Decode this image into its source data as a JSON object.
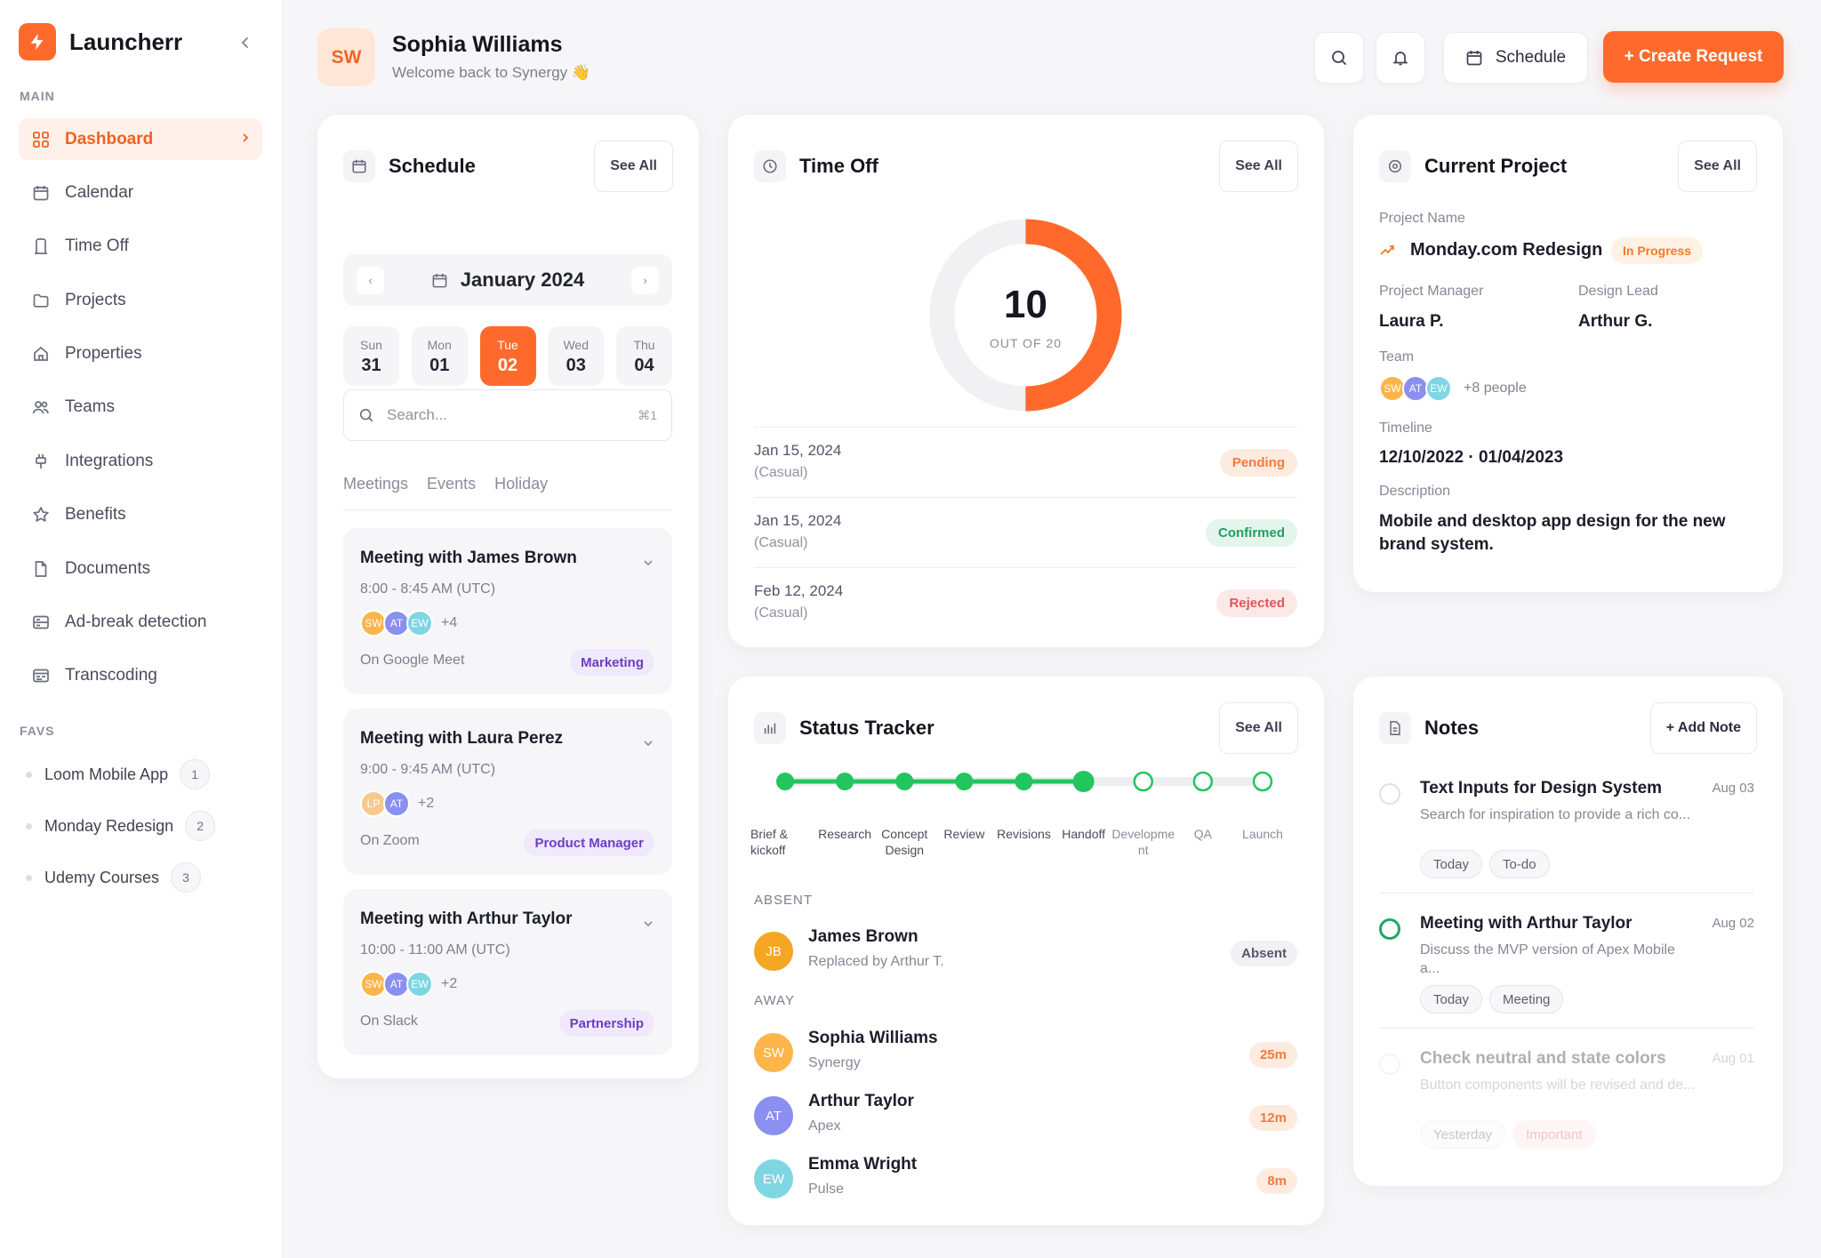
{
  "brand": {
    "name": "Launcherr"
  },
  "sidebar": {
    "main_label": "MAIN",
    "items": [
      {
        "label": "Dashboard",
        "icon": "grid-icon",
        "active": true
      },
      {
        "label": "Calendar",
        "icon": "calendar-icon"
      },
      {
        "label": "Time Off",
        "icon": "bookmark-icon"
      },
      {
        "label": "Projects",
        "icon": "folder-icon"
      },
      {
        "label": "Properties",
        "icon": "home-icon"
      },
      {
        "label": "Teams",
        "icon": "users-icon"
      },
      {
        "label": "Integrations",
        "icon": "plug-icon"
      },
      {
        "label": "Benefits",
        "icon": "star-icon"
      },
      {
        "label": "Documents",
        "icon": "document-icon"
      },
      {
        "label": "Ad-break detection",
        "icon": "server-icon"
      },
      {
        "label": "Transcoding",
        "icon": "transcode-icon"
      }
    ],
    "favs_label": "FAVS",
    "favs": [
      {
        "label": "Loom Mobile App",
        "count": "1"
      },
      {
        "label": "Monday Redesign",
        "count": "2"
      },
      {
        "label": "Udemy Courses",
        "count": "3"
      }
    ]
  },
  "header": {
    "initials": "SW",
    "name": "Sophia Williams",
    "welcome": "Welcome back to Synergy 👋",
    "schedule_label": "Schedule",
    "create_label": "+ Create Request"
  },
  "schedule": {
    "title": "Schedule",
    "see_all": "See All",
    "month": "January 2024",
    "prev": "‹",
    "next": "›",
    "days": [
      {
        "name": "Sun",
        "num": "31"
      },
      {
        "name": "Mon",
        "num": "01"
      },
      {
        "name": "Tue",
        "num": "02",
        "selected": true
      },
      {
        "name": "Wed",
        "num": "03"
      },
      {
        "name": "Thu",
        "num": "04"
      }
    ],
    "search_placeholder": "Search...",
    "search_shortcut": "⌘1",
    "tabs": [
      "Meetings",
      "Events",
      "Holiday"
    ],
    "meetings": [
      {
        "title": "Meeting with James Brown",
        "time": "8:00 - 8:45 AM (UTC)",
        "avatars": [
          "SW",
          "AT",
          "EW"
        ],
        "more": "+4",
        "where": "On Google Meet",
        "tag": "Marketing"
      },
      {
        "title": "Meeting with Laura Perez",
        "time": "9:00 - 9:45 AM (UTC)",
        "avatars": [
          "LP",
          "AT"
        ],
        "more": "+2",
        "where": "On Zoom",
        "tag": "Product Manager"
      },
      {
        "title": "Meeting with Arthur Taylor",
        "time": "10:00 - 11:00 AM (UTC)",
        "avatars": [
          "SW",
          "AT",
          "EW"
        ],
        "more": "+2",
        "where": "On Slack",
        "tag": "Partnership"
      }
    ]
  },
  "time_off": {
    "title": "Time Off",
    "see_all": "See All",
    "used": 10,
    "total": 20,
    "value": "10",
    "out_of": "OUT OF 20",
    "entries": [
      {
        "date": "Jan 15, 2024",
        "type": "(Casual)",
        "status": "Pending",
        "color": "#f47a3b",
        "bg": "#fdebe0"
      },
      {
        "date": "Jan 15, 2024",
        "type": "(Casual)",
        "status": "Confirmed",
        "color": "#1f9f63",
        "bg": "#e4f5ec"
      },
      {
        "date": "Feb 12, 2024",
        "type": "(Casual)",
        "status": "Rejected",
        "color": "#e0565b",
        "bg": "#fde8e8"
      }
    ]
  },
  "project": {
    "title": "Current Project",
    "see_all": "See All",
    "name_label": "Project Name",
    "name": "Monday.com Redesign",
    "status": "In Progress",
    "manager_label": "Project Manager",
    "manager": "Laura P.",
    "lead_label": "Design Lead",
    "lead": "Arthur G.",
    "team_label": "Team",
    "team_avatars": [
      "SW",
      "AT",
      "EW"
    ],
    "team_more": "+8 people",
    "timeline_label": "Timeline",
    "timeline": "12/10/2022 · 01/04/2023",
    "description_label": "Description",
    "description": "Mobile and desktop app design for the new brand system."
  },
  "status_tracker": {
    "title": "Status Tracker",
    "see_all": "See All",
    "completed": 6,
    "steps": [
      "Brief & kickoff",
      "Research",
      "Concept Design",
      "Review",
      "Revisions",
      "Handoff",
      "Development",
      "QA",
      "Launch"
    ],
    "step_label_lines": [
      [
        "Brief &",
        "kickoff"
      ],
      [
        "Research"
      ],
      [
        "Concept Design"
      ],
      [
        "Review"
      ],
      [
        "Revisions"
      ],
      [
        "Handoff"
      ],
      [
        "Developme",
        "nt"
      ],
      [
        "QA"
      ],
      [
        "Launch"
      ]
    ],
    "absent_label": "ABSENT",
    "away_label": "AWAY",
    "absent": [
      {
        "initials": "JB",
        "name": "James Brown",
        "sub": "Replaced by Arthur T.",
        "badge": "Absent",
        "color": "#f5a623"
      }
    ],
    "away": [
      {
        "initials": "SW",
        "name": "Sophia Williams",
        "sub": "Synergy",
        "badge": "25m",
        "color": "#fbb548"
      },
      {
        "initials": "AT",
        "name": "Arthur Taylor",
        "sub": "Apex",
        "badge": "12m",
        "color": "#8a8ff0"
      },
      {
        "initials": "EW",
        "name": "Emma Wright",
        "sub": "Pulse",
        "badge": "8m",
        "color": "#7fd6e3"
      }
    ]
  },
  "notes": {
    "title": "Notes",
    "add_label": "+ Add Note",
    "items": [
      {
        "title": "Text Inputs for Design System",
        "desc": "Search for inspiration to provide a rich co...",
        "date": "Aug 03",
        "tags": [
          "Today",
          "To-do"
        ]
      },
      {
        "title": "Meeting with Arthur Taylor",
        "desc": "Discuss the MVP version of Apex Mobile a...",
        "date": "Aug 02",
        "tags": [
          "Today",
          "Meeting"
        ]
      },
      {
        "title": "Check neutral and state colors",
        "desc": "Button components will be revised and de...",
        "date": "Aug 01",
        "tags": [
          "Yesterday",
          "Important"
        ]
      }
    ]
  },
  "colors": {
    "accent": "#ff6a2c",
    "progress_green": "#22c55e",
    "text": "#1b1d29"
  }
}
